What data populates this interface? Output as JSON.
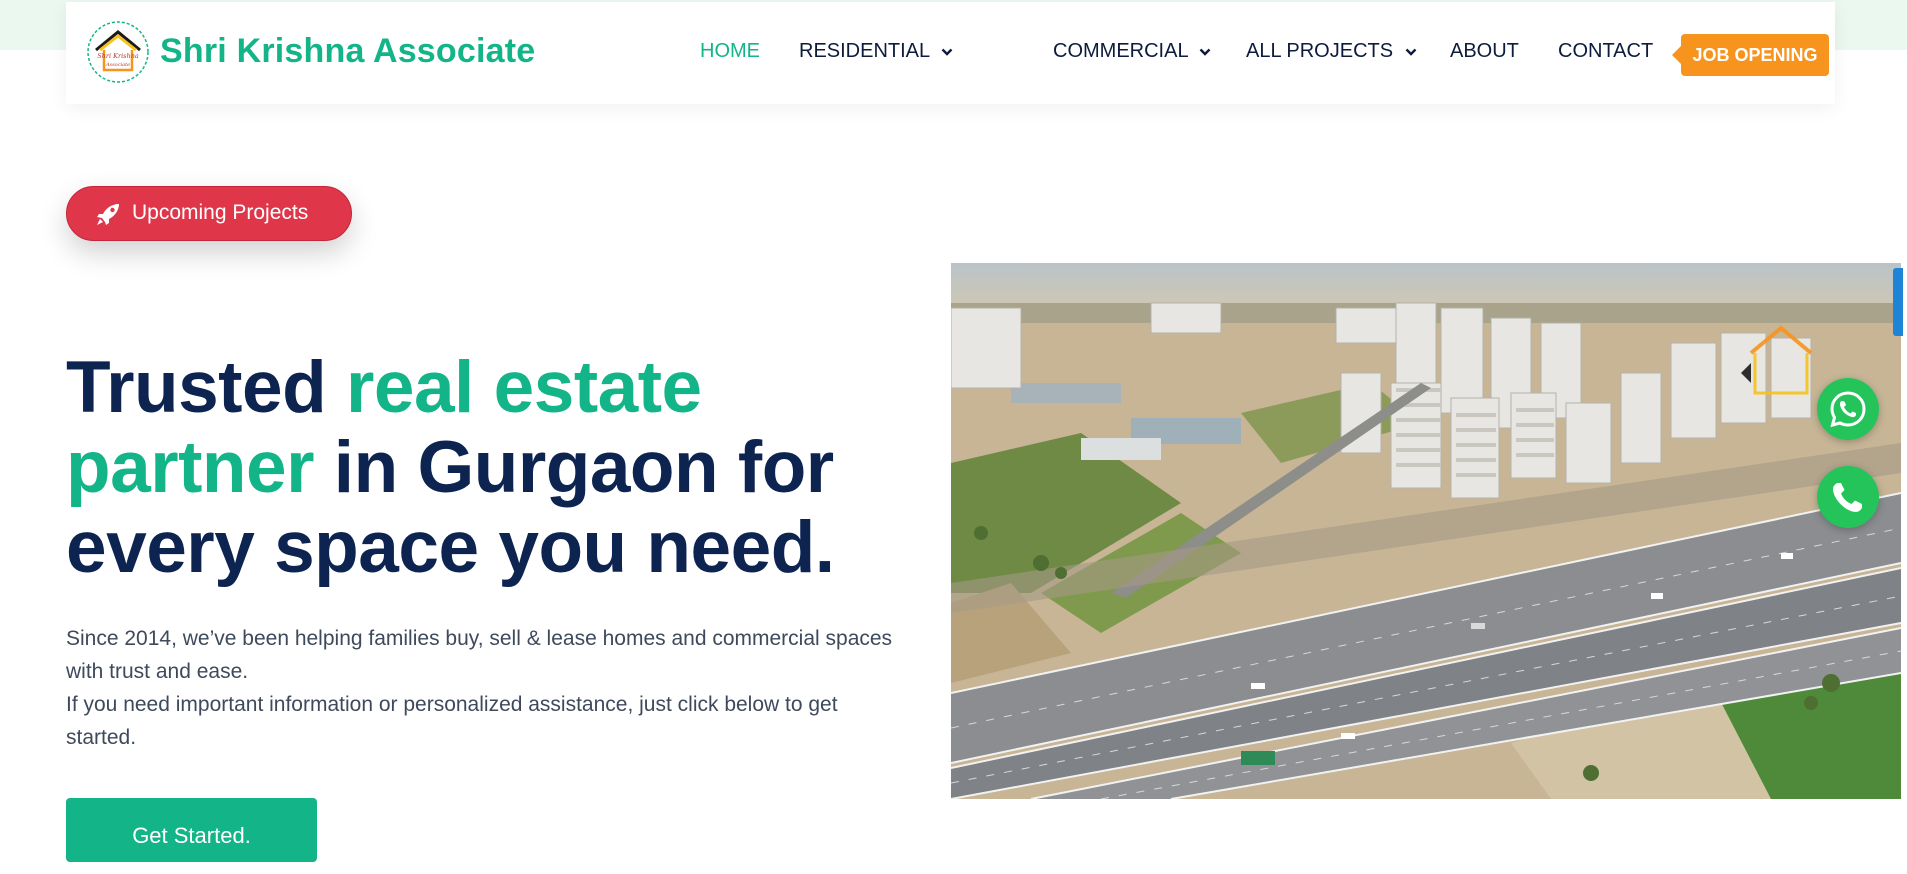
{
  "header": {
    "brand": "Shri Krishna Associate",
    "logo_text": "Shri Krishna Associate",
    "nav": [
      {
        "label": "HOME",
        "active": true,
        "dropdown": false
      },
      {
        "label": "RESIDENTIAL",
        "active": false,
        "dropdown": true
      },
      {
        "label": "COMMERCIAL",
        "active": false,
        "dropdown": true
      },
      {
        "label": "ALL PROJECTS",
        "active": false,
        "dropdown": true
      },
      {
        "label": "ABOUT",
        "active": false,
        "dropdown": false
      },
      {
        "label": "CONTACT",
        "active": false,
        "dropdown": false
      }
    ],
    "job_button": "JOB OPENING"
  },
  "hero": {
    "upcoming_label": "Upcoming Projects",
    "headline": {
      "part1": "Trusted ",
      "highlight1": "real estate",
      "highlight2": "partner",
      "part2": " in Gurgaon for every space you need."
    },
    "description_line1": "Since 2014, we’ve been helping families buy, sell & lease homes and commercial spaces with trust and ease.",
    "description_line2": "If you need important information or personalized assistance, just click below to get started.",
    "cta": "Get Started."
  },
  "floating": {
    "whatsapp_icon": "whatsapp-icon",
    "phone_icon": "phone-icon"
  },
  "colors": {
    "accent_green": "#13b588",
    "navy": "#0d2350",
    "job_orange": "#f7941d",
    "upcoming_red": "#e0364a",
    "whatsapp_green": "#25c45a"
  }
}
